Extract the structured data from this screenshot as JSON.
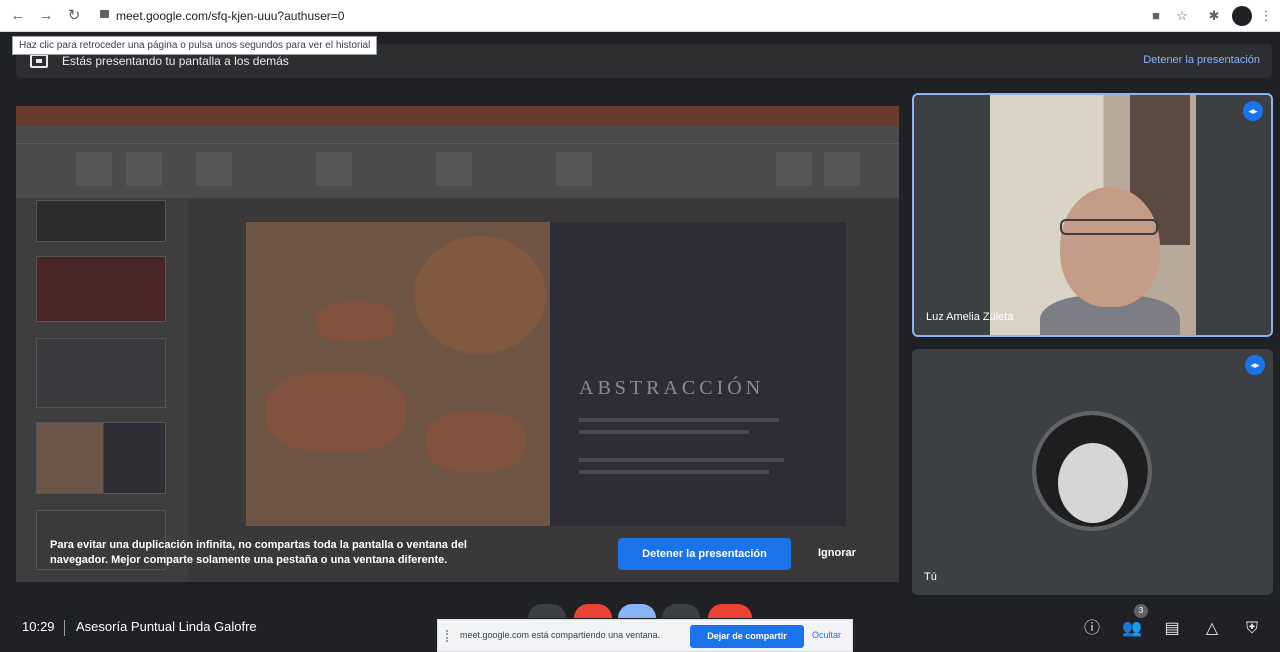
{
  "browser": {
    "url": "meet.google.com/sfq-kjen-uuu?authuser=0",
    "tooltip": "Haz clic para retroceder una página o pulsa unos segundos para ver el historial",
    "icons": [
      "back-arrow-icon",
      "forward-arrow-icon",
      "reload-icon",
      "lock-icon",
      "camera-icon",
      "star-icon",
      "extensions-icon",
      "profile-icon",
      "menu-icon"
    ]
  },
  "presenting_bar": {
    "text": "Estás presentando tu pantalla a los demás",
    "stop_label": "Detener la presentación"
  },
  "shared_screen": {
    "slide_title": "ABSTRACCIÓN",
    "warning": {
      "text": "Para evitar una duplicación infinita, no compartas toda la pantalla o ventana del navegador. Mejor comparte solamente una pestaña o una ventana diferente.",
      "stop_button": "Detener la presentación",
      "ignore_button": "Ignorar"
    }
  },
  "participants": [
    {
      "name": "Luz Amelia Zuleta",
      "speaking": true
    },
    {
      "name": "Tú",
      "speaking": true
    }
  ],
  "bottom_bar": {
    "time": "10:29",
    "meeting_name": "Asesoría Puntual Linda Galofre",
    "participant_count": "3"
  },
  "share_notice": {
    "message": "meet.google.com está compartiendo una ventana.",
    "stop_label": "Dejar de compartir",
    "hide_label": "Ocultar"
  },
  "colors": {
    "accent": "#1a73e8",
    "link": "#8ab4f8",
    "background": "#202124"
  }
}
